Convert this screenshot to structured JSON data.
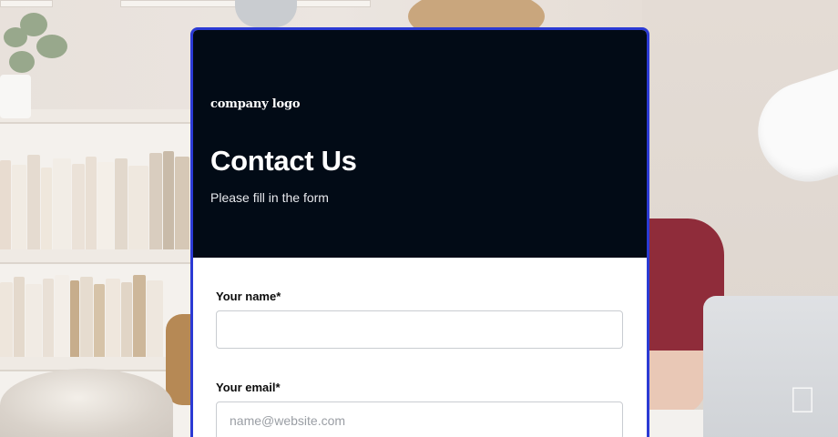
{
  "form": {
    "logo_text": "company logo",
    "title": "Contact Us",
    "subtitle": "Please fill in the form",
    "fields": [
      {
        "label": "Your name*",
        "value": "",
        "placeholder": ""
      },
      {
        "label": "Your email*",
        "value": "",
        "placeholder": "name@website.com"
      }
    ]
  },
  "colors": {
    "header_bg": "#020b16",
    "card_border": "#2b3ad4",
    "field_border": "#c9ccd1"
  },
  "icons": {
    "laptop_logo": "apple-icon"
  }
}
